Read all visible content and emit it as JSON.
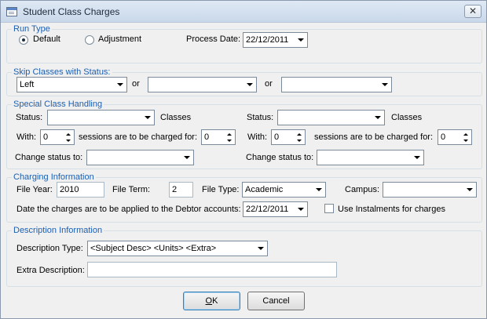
{
  "window": {
    "title": "Student Class Charges",
    "close_label": "✕"
  },
  "run_type": {
    "legend": "Run Type",
    "default_label": "Default",
    "adjustment_label": "Adjustment",
    "process_date_label": "Process Date:",
    "process_date": "22/12/2011",
    "selected": "Default"
  },
  "skip": {
    "legend": "Skip Classes with Status:",
    "status1": "Left",
    "status2": "",
    "status3": "",
    "or1": "or",
    "or2": "or"
  },
  "special": {
    "legend": "Special Class Handling",
    "status_label": "Status:",
    "classes_label": "Classes",
    "with_label": "With:",
    "sessions_label": "sessions are to be charged for:",
    "change_label": "Change status to:",
    "left": {
      "status": "",
      "with": "0",
      "charged": "0",
      "change": ""
    },
    "right": {
      "status": "",
      "with": "0",
      "charged": "0",
      "change": ""
    }
  },
  "charging": {
    "legend": "Charging Information",
    "file_year_label": "File Year:",
    "file_year": "2010",
    "file_term_label": "File Term:",
    "file_term": "2",
    "file_type_label": "File Type:",
    "file_type": "Academic",
    "campus_label": "Campus:",
    "campus": "",
    "date_label": "Date the charges are to be applied to the Debtor accounts:",
    "date": "22/12/2011",
    "instalments_label": "Use Instalments for charges",
    "instalments_checked": false
  },
  "description": {
    "legend": "Description Information",
    "type_label": "Description Type:",
    "type": "<Subject Desc> <Units> <Extra>",
    "extra_label": "Extra Description:",
    "extra": ""
  },
  "buttons": {
    "ok_accel": "O",
    "ok_rest": "K",
    "cancel": "Cancel"
  }
}
